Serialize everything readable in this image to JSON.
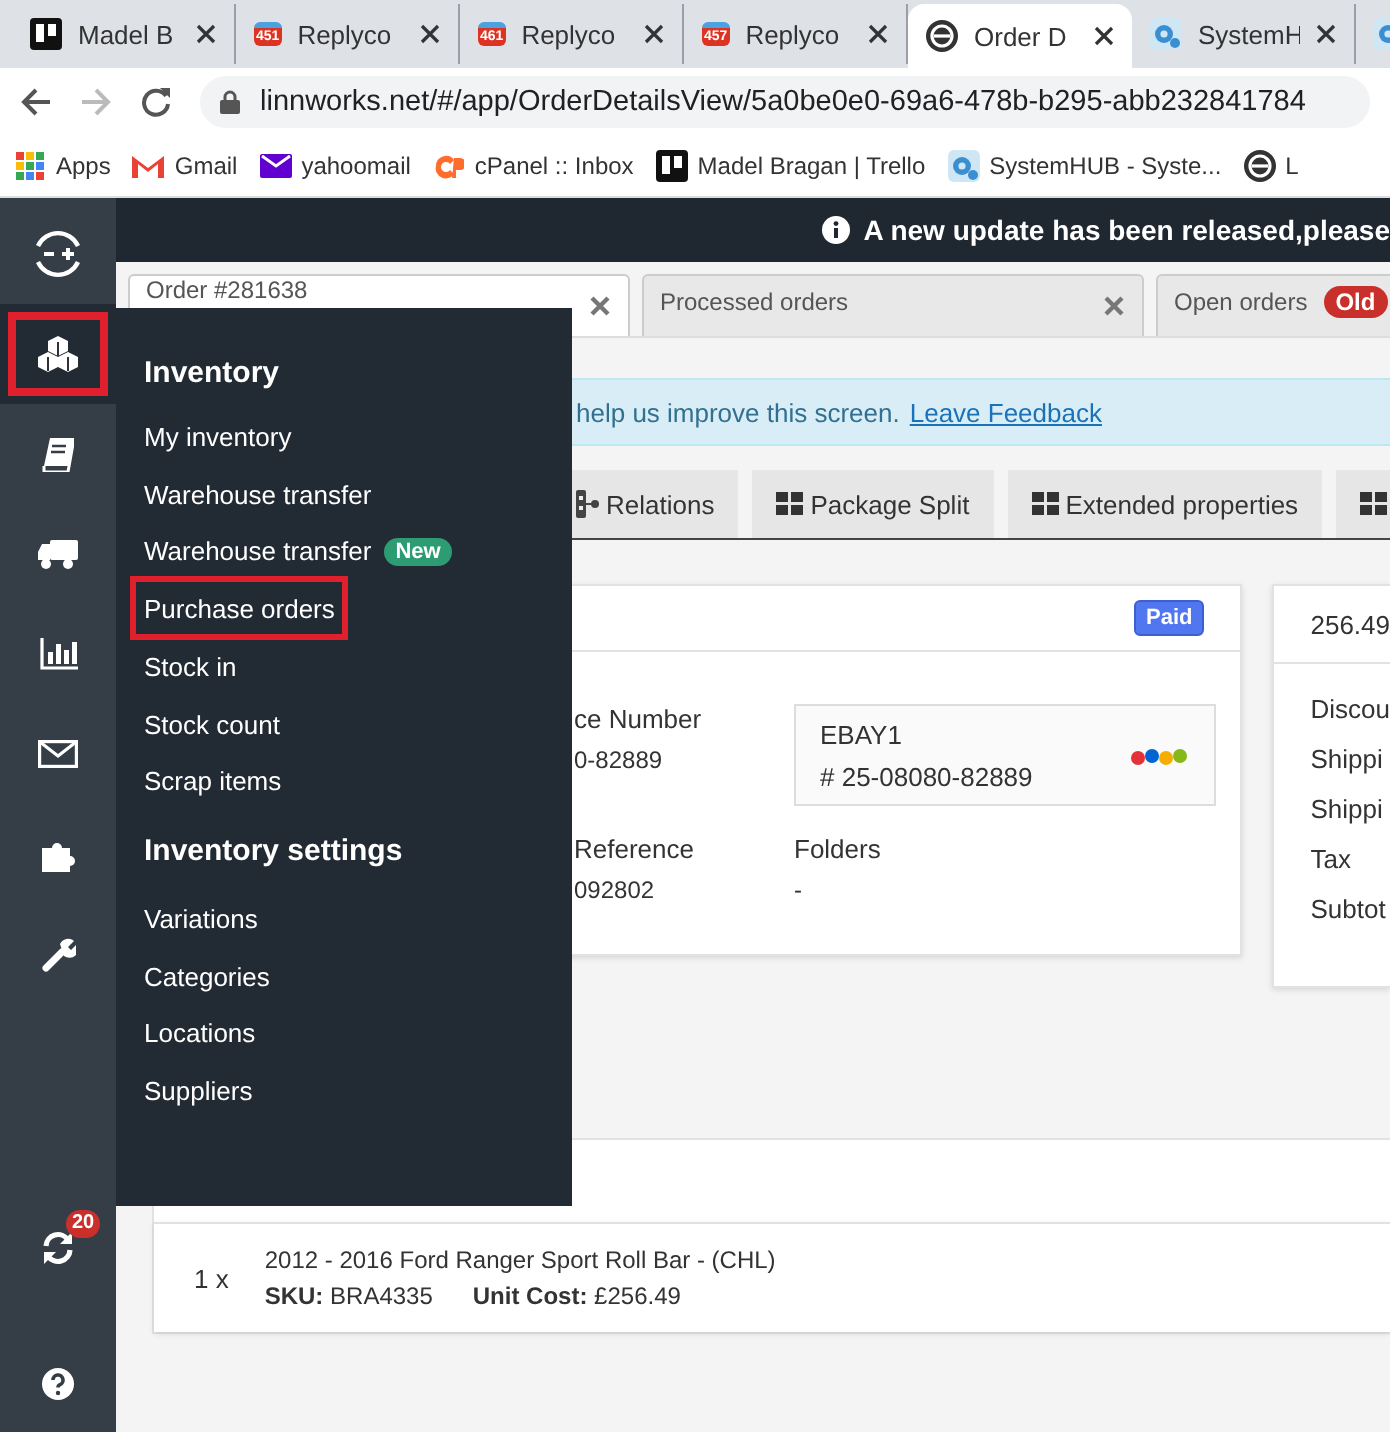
{
  "browser_tabs": [
    {
      "title": "Madel B",
      "selected": false
    },
    {
      "title": "Replyco",
      "badge": "451",
      "selected": false
    },
    {
      "title": "Replyco",
      "badge": "461",
      "selected": false
    },
    {
      "title": "Replyco",
      "badge": "457",
      "selected": false
    },
    {
      "title": "Order D",
      "selected": true
    },
    {
      "title": "SystemH",
      "selected": false
    },
    {
      "selected": false
    }
  ],
  "address": "linnworks.net/#/app/OrderDetailsView/5a0be0e0-69a6-478b-b295-abb232841784",
  "bookmarks": [
    "Apps",
    "Gmail",
    "yahoomail",
    "cPanel :: Inbox",
    "Madel Bragan | Trello",
    "SystemHUB - Syste...",
    "L"
  ],
  "notice": "A new update has been released,please",
  "rail": [
    {
      "selected": false,
      "highlighted": false
    },
    {
      "selected": true,
      "highlighted": true
    },
    {
      "selected": false,
      "highlighted": false
    },
    {
      "selected": false,
      "highlighted": false
    },
    {
      "selected": false,
      "highlighted": false
    },
    {
      "selected": false,
      "highlighted": false
    },
    {
      "selected": false,
      "highlighted": false
    },
    {
      "selected": false,
      "highlighted": false
    },
    {
      "badge": "20",
      "selected": false,
      "highlighted": false
    },
    {
      "selected": false,
      "highlighted": false
    }
  ],
  "menu": [
    {
      "heading": "Inventory",
      "items": [
        {
          "label": "My inventory",
          "highlighted": false
        },
        {
          "label": "Warehouse transfer",
          "highlighted": false
        },
        {
          "label": "Warehouse transfer",
          "badge": "New",
          "highlighted": false
        },
        {
          "label": "Purchase orders",
          "highlighted": true
        },
        {
          "label": "Stock in",
          "highlighted": false
        },
        {
          "label": "Stock count",
          "highlighted": false
        },
        {
          "label": "Scrap items",
          "highlighted": false
        }
      ]
    },
    {
      "heading": "Inventory settings",
      "items": [
        {
          "label": "Variations",
          "highlighted": false
        },
        {
          "label": "Categories",
          "highlighted": false
        },
        {
          "label": "Locations",
          "highlighted": false
        },
        {
          "label": "Suppliers",
          "highlighted": false
        }
      ]
    }
  ],
  "order_tabs": [
    {
      "label": "Order #281638",
      "closable": true,
      "selected": true
    },
    {
      "label": "Processed orders",
      "closable": true,
      "selected": false
    },
    {
      "label": "Open orders",
      "badge": "Old",
      "closable": false,
      "selected": false
    }
  ],
  "feedback": {
    "text": "help us improve this screen.",
    "link": "Leave Feedback"
  },
  "detail_tabs": [
    {
      "kind": "labeled",
      "label": "Relations"
    },
    {
      "kind": "labeled",
      "label": "Package Split"
    },
    {
      "kind": "labeled",
      "label": "Extended properties"
    },
    {
      "kind": "iconic"
    }
  ],
  "order_card": {
    "status": "Paid",
    "fields": [
      {
        "label": "ce Number",
        "value": "0-82889"
      },
      {
        "label": "Reference",
        "value": "092802"
      },
      {
        "label": "Folders",
        "value": "-"
      }
    ],
    "channel": {
      "name": "EBAY1",
      "number": "# 25-08080-82889"
    }
  },
  "totals_card": {
    "header": "256.49",
    "rows": [
      "Discou",
      "Shippi",
      "Shippi",
      "Tax",
      "Subtot"
    ]
  },
  "item": {
    "quantity": "1 x",
    "title": "2012 - 2016 Ford Ranger Sport Roll Bar - (CHL)",
    "sku_label": "SKU:",
    "sku": "BRA4335",
    "cost_label": "Unit Cost:",
    "cost": "£256.49"
  }
}
